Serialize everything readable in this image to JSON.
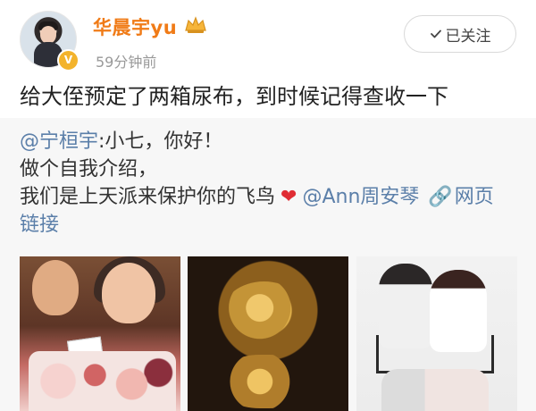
{
  "post": {
    "username": "华晨宇yu",
    "timestamp": "59分钟前",
    "follow_label": "已关注",
    "text": "给大侄预定了两箱尿布，到时候记得查收一下"
  },
  "repost": {
    "mention1": "@宁桓宇",
    "line1_rest": ":小七，你好！",
    "line2": "做个自我介绍，",
    "line3_start": "我们是上天派来保护你的飞鸟",
    "mention2": "@Ann周安琴",
    "link_text": "网页",
    "link_line2": "链接"
  },
  "icons": {
    "crown": "crown-icon",
    "verify": "verified-badge-icon",
    "check": "check-icon",
    "heart": "heart-icon",
    "link": "link-icon"
  },
  "colors": {
    "username": "#f07b17",
    "mention": "#5b7fa9",
    "heart": "#e02d34",
    "repost_bg": "#f7f7f7"
  }
}
